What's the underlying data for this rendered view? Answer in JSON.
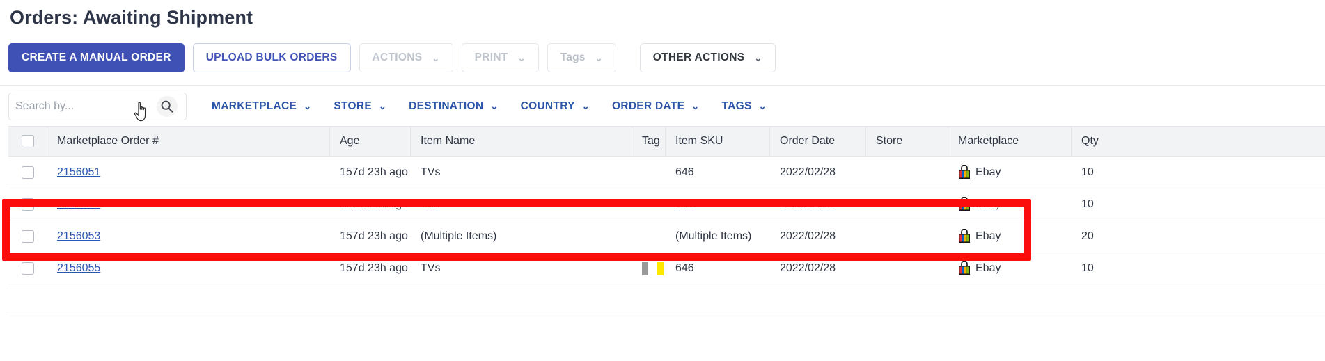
{
  "page": {
    "title": "Orders: Awaiting Shipment"
  },
  "toolbar": {
    "buttons": [
      {
        "label": "CREATE A MANUAL ORDER",
        "style": "primary",
        "caret": false,
        "disabled": false
      },
      {
        "label": "UPLOAD BULK ORDERS",
        "style": "outline",
        "caret": false,
        "disabled": false
      },
      {
        "label": "ACTIONS",
        "style": "ghost",
        "caret": true,
        "disabled": true
      },
      {
        "label": "PRINT",
        "style": "ghost",
        "caret": true,
        "disabled": true
      },
      {
        "label": "Tags",
        "style": "ghost",
        "caret": true,
        "disabled": true
      },
      {
        "label": "OTHER ACTIONS",
        "style": "dark",
        "caret": true,
        "disabled": false
      }
    ],
    "caret_glyph": "⌄"
  },
  "search": {
    "placeholder": "Search by...",
    "value": "",
    "icon": "search-icon"
  },
  "filters": [
    {
      "label": "MARKETPLACE"
    },
    {
      "label": "STORE"
    },
    {
      "label": "DESTINATION"
    },
    {
      "label": "COUNTRY"
    },
    {
      "label": "ORDER DATE"
    },
    {
      "label": "TAGS"
    }
  ],
  "table": {
    "columns": [
      {
        "key": "check",
        "label": ""
      },
      {
        "key": "order",
        "label": "Marketplace Order #"
      },
      {
        "key": "age",
        "label": "Age"
      },
      {
        "key": "item",
        "label": "Item Name"
      },
      {
        "key": "tag",
        "label": "Tag"
      },
      {
        "key": "sku",
        "label": "Item SKU"
      },
      {
        "key": "date",
        "label": "Order Date"
      },
      {
        "key": "store",
        "label": "Store"
      },
      {
        "key": "mkt",
        "label": "Marketplace"
      },
      {
        "key": "qty",
        "label": "Qty"
      }
    ],
    "rows": [
      {
        "order": "2156051",
        "age": "157d 23h ago",
        "item": "TVs",
        "tags": [],
        "sku": "646",
        "date": "2022/02/28",
        "store": "",
        "marketplace": "Ebay",
        "qty": "10"
      },
      {
        "order": "2156052",
        "age": "157d 23h ago",
        "item": "TVs",
        "tags": [],
        "sku": "646",
        "date": "2022/02/28",
        "store": "",
        "marketplace": "Ebay",
        "qty": "10"
      },
      {
        "order": "2156053",
        "age": "157d 23h ago",
        "item": "(Multiple Items)",
        "tags": [],
        "sku": "(Multiple Items)",
        "date": "2022/02/28",
        "store": "",
        "marketplace": "Ebay",
        "qty": "20"
      },
      {
        "order": "2156055",
        "age": "157d 23h ago",
        "item": "TVs",
        "tags": [
          "#9a9a9a",
          "#ffffff",
          "#ffe800"
        ],
        "sku": "646",
        "date": "2022/02/28",
        "store": "",
        "marketplace": "Ebay",
        "qty": "10"
      },
      {
        "order": "",
        "age": "",
        "item": "",
        "tags": [],
        "sku": "",
        "date": "",
        "store": "",
        "marketplace": "",
        "qty": ""
      }
    ]
  },
  "annotation": {
    "shape": "rectangle",
    "color": "#fc0d0d",
    "note": "highlight-box-over-order-rows"
  },
  "colors": {
    "primary": "#3f51b5",
    "link": "#2b56b0",
    "filter_text": "#2c55a8",
    "header_bg": "#f2f3f5",
    "annotation": "#fc0d0d"
  },
  "cursor": {
    "type": "pointer-hand"
  }
}
